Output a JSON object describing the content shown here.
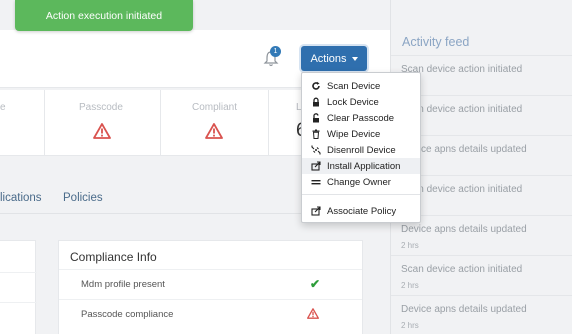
{
  "toast": {
    "text": "Action execution initiated"
  },
  "header": {
    "notification_count": "1",
    "actions_label": "Actions"
  },
  "stats": {
    "partial_label": "e",
    "passcode_label": "Passcode",
    "compliant_label": "Compliant",
    "partial_label_right": "L",
    "partial_number": "6"
  },
  "tabs": [
    {
      "label": "lications"
    },
    {
      "label": "Policies"
    }
  ],
  "compliance": {
    "title": "Compliance Info",
    "rows": [
      {
        "label": "Mdm profile present",
        "status": "check"
      },
      {
        "label": "Passcode compliance",
        "status": "warning"
      }
    ]
  },
  "actions_menu": {
    "items": [
      {
        "label": "Scan Device",
        "icon": "refresh-icon"
      },
      {
        "label": "Lock Device",
        "icon": "lock-icon"
      },
      {
        "label": "Clear Passcode",
        "icon": "unlock-icon"
      },
      {
        "label": "Wipe Device",
        "icon": "trash-icon"
      },
      {
        "label": "Disenroll Device",
        "icon": "disenroll-icon"
      },
      {
        "label": "Install Application",
        "icon": "install-icon"
      },
      {
        "label": "Change Owner",
        "icon": "owner-icon"
      },
      {
        "label": "Associate Policy",
        "icon": "policy-icon"
      }
    ],
    "highlighted": "Install Application"
  },
  "activity_feed": {
    "title": "Activity feed",
    "items": [
      {
        "text": "Scan device action initiated",
        "time": "mins"
      },
      {
        "text": "Scan device action initiated",
        "time": "hrs"
      },
      {
        "text": "Device apns details updated",
        "time": "hrs"
      },
      {
        "text": "Scan device action initiated",
        "time": "hrs"
      },
      {
        "text": "Device apns details updated",
        "time": "2 hrs"
      },
      {
        "text": "Scan device action initiated",
        "time": "2 hrs"
      },
      {
        "text": "Device apns details updated",
        "time": "2 hrs"
      }
    ]
  },
  "colors": {
    "toast_bg": "#5cb85c",
    "primary": "#2f6fae",
    "warning": "#d9534f",
    "success": "#2e9d3a"
  }
}
